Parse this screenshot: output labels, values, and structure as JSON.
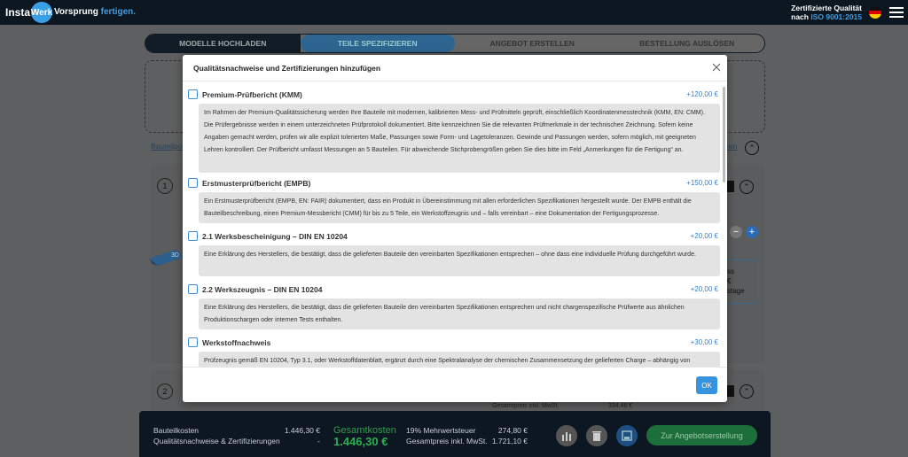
{
  "header": {
    "logo_left": "Insta",
    "logo_right": "Werk",
    "slogan_prefix": "Vorsprung",
    "slogan_suffix": "fertigen.",
    "cert_line1": "Zertifizierte Qualität",
    "cert_line2_prefix": "nach",
    "cert_line2_iso": "ISO 9001:2015"
  },
  "steps": [
    "MODELLE HOCHLADEN",
    "TEILE SPEZIFIZIEREN",
    "ANGEBOT ERSTELLEN",
    "BESTELLUNG AUSLÖSEN"
  ],
  "background": {
    "card_link_left": "Bauteilpo",
    "card_link_right": "ren",
    "part1_index": "1",
    "part2_index": "2",
    "side_box_line1": "ss",
    "side_box_line2": "€",
    "side_box_line3": "stage",
    "model_tag": "3D",
    "partial_label": "Gesamtpreis inkl. MwSt.",
    "partial_value": "334,46 €"
  },
  "summary": {
    "parts_label": "Bauteilkosten",
    "parts_value": "1.446,30 €",
    "quality_label": "Qualitätsnachweise & Zertifizierungen",
    "quality_value": "-",
    "total_label": "Gesamtkosten",
    "total_value": "1.446,30 €",
    "vat_label": "19% Mehrwertsteuer",
    "vat_value": "274,80 €",
    "gross_label": "Gesamtpreis inkl. MwSt.",
    "gross_value": "1.721,10 €",
    "quote_button": "Zur Angebotserstellung"
  },
  "modal": {
    "title": "Qualitätsnachweise und Zertifizierungen hinzufügen",
    "ok_label": "OK",
    "options": [
      {
        "title": "Premium-Prüfbericht (KMM)",
        "price": "+120,00 €",
        "description": "Im Rahmen der Premium-Qualitätssicherung werden Ihre Bauteile mit modernen, kalibrierten Mess- und Prüfmitteln geprüft, einschließlich Koordinatenmesstechnik (KMM, EN: CMM). Die Prüfergebnisse werden in einem unterzeichneten Prüfprotokoll dokumentiert. Bitte kennzeichnen Sie die relevanten Prüfmerkmale in der technischen Zeichnung. Sofern keine Angaben gemacht werden, prüfen wir alle explizit tolerierten Maße, Passungen sowie Form- und Lagetoleranzen. Gewinde und Passungen werden, sofern möglich, mit geeigneten Lehren kontrolliert. Der Prüfbericht umfasst Messungen an 5 Bauteilen. Für abweichende Stichprobengrößen geben Sie dies bitte im Feld „Anmerkungen für die Fertigung“ an."
      },
      {
        "title": "Erstmusterprüfbericht (EMPB)",
        "price": "+150,00 €",
        "description": "Ein Erstmusterprüfbericht (EMPB, EN: FAIR) dokumentiert, dass ein Produkt in Übereinstimmung mit allen erforderlichen Spezifikationen hergestellt wurde. Der EMPB enthält die Bauteilbeschreibung, einen Premium-Messbericht (CMM) für bis zu 5 Teile, ein Werkstoffzeugnis und – falls vereinbart – eine Dokumentation der Fertigungsprozesse."
      },
      {
        "title": "2.1 Werksbescheinigung – DIN EN 10204",
        "price": "+20,00 €",
        "description": "Eine Erklärung des Herstellers, die bestätigt, dass die gelieferten Bauteile den vereinbarten Spezifikationen entsprechen – ohne dass eine individuelle Prüfung durchgeführt wurde."
      },
      {
        "title": "2.2 Werkszeugnis – DIN EN 10204",
        "price": "+20,00 €",
        "description": "Eine Erklärung des Herstellers, die bestätigt, dass die gelieferten Bauteile den vereinbarten Spezifikationen entsprechen und nicht chargenspezifische Prüfwerte aus ähnlichen Produktionschargen oder internen Tests enthalten."
      },
      {
        "title": "Werkstoffnachweis",
        "price": "+30,00 €",
        "description": "Prüfzeugnis gemäß EN 10204, Typ 3.1, oder Werkstoffdatenblatt, ergänzt durch eine Spektralanalyse der chemischen Zusammensetzung der gelieferten Charge – abhängig von"
      }
    ]
  }
}
